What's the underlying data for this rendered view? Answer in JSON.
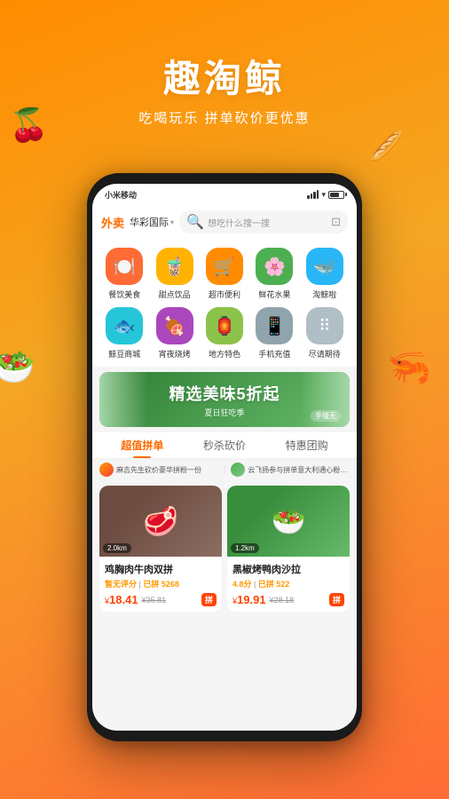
{
  "app": {
    "title": "趣淘鲸",
    "subtitle": "吃喝玩乐 拼单砍价更优惠"
  },
  "status_bar": {
    "carrier": "小米移动",
    "time": ""
  },
  "header": {
    "waimai_label": "外卖",
    "location": "华彩国际",
    "search_placeholder": "想吃什么搜一搜"
  },
  "categories": [
    {
      "icon": "🍽️",
      "label": "餐饮美食",
      "color": "cat-red"
    },
    {
      "icon": "🧋",
      "label": "甜点饮品",
      "color": "cat-yellow"
    },
    {
      "icon": "🛒",
      "label": "超市便利",
      "color": "cat-orange"
    },
    {
      "icon": "🌸",
      "label": "鲜花水果",
      "color": "cat-green"
    },
    {
      "icon": "🐳",
      "label": "淘鲸啦",
      "color": "cat-blue"
    },
    {
      "icon": "🐟",
      "label": "鲸豆商城",
      "color": "cat-teal"
    },
    {
      "icon": "🍖",
      "label": "宵夜烧烤",
      "color": "cat-purple"
    },
    {
      "icon": "🏮",
      "label": "地方特色",
      "color": "cat-lime"
    },
    {
      "icon": "📱",
      "label": "手机充值",
      "color": "cat-gray"
    },
    {
      "icon": "⠿",
      "label": "尽请期待",
      "color": "cat-light"
    }
  ],
  "banner": {
    "main_text": "精选美味5折起",
    "sub_text": "夏日狂吃季",
    "tag_text": "手慢无"
  },
  "tabs": [
    {
      "label": "超值拼单",
      "active": true
    },
    {
      "label": "秒杀砍价",
      "active": false
    },
    {
      "label": "特惠团购",
      "active": false
    }
  ],
  "promo_rows": [
    {
      "text": "麻吉先生砍价豪华拼粉一份",
      "avatar_color": "#ff9800"
    },
    {
      "text": "云飞扬参与拼单意大利通心粉一份",
      "avatar_color": "#4caf50"
    }
  ],
  "products": [
    {
      "name": "鸡胸肉牛肉双拼",
      "distance": "2.0km",
      "rating": "",
      "rating_label": "暂无评分",
      "join_count": "已拼 5268",
      "price_current": "¥18.41",
      "price_original": "¥35.81",
      "bg": "left"
    },
    {
      "name": "黑椒烤鸭肉沙拉",
      "distance": "1.2km",
      "rating": "4.8",
      "rating_label": "4.8分",
      "join_count": "已拼 522",
      "price_current": "¥19.91",
      "price_original": "¥28.18",
      "bg": "right"
    }
  ],
  "pinjie_label": "拼",
  "colors": {
    "brand_orange": "#ff6b00",
    "brand_red": "#ff4400"
  }
}
